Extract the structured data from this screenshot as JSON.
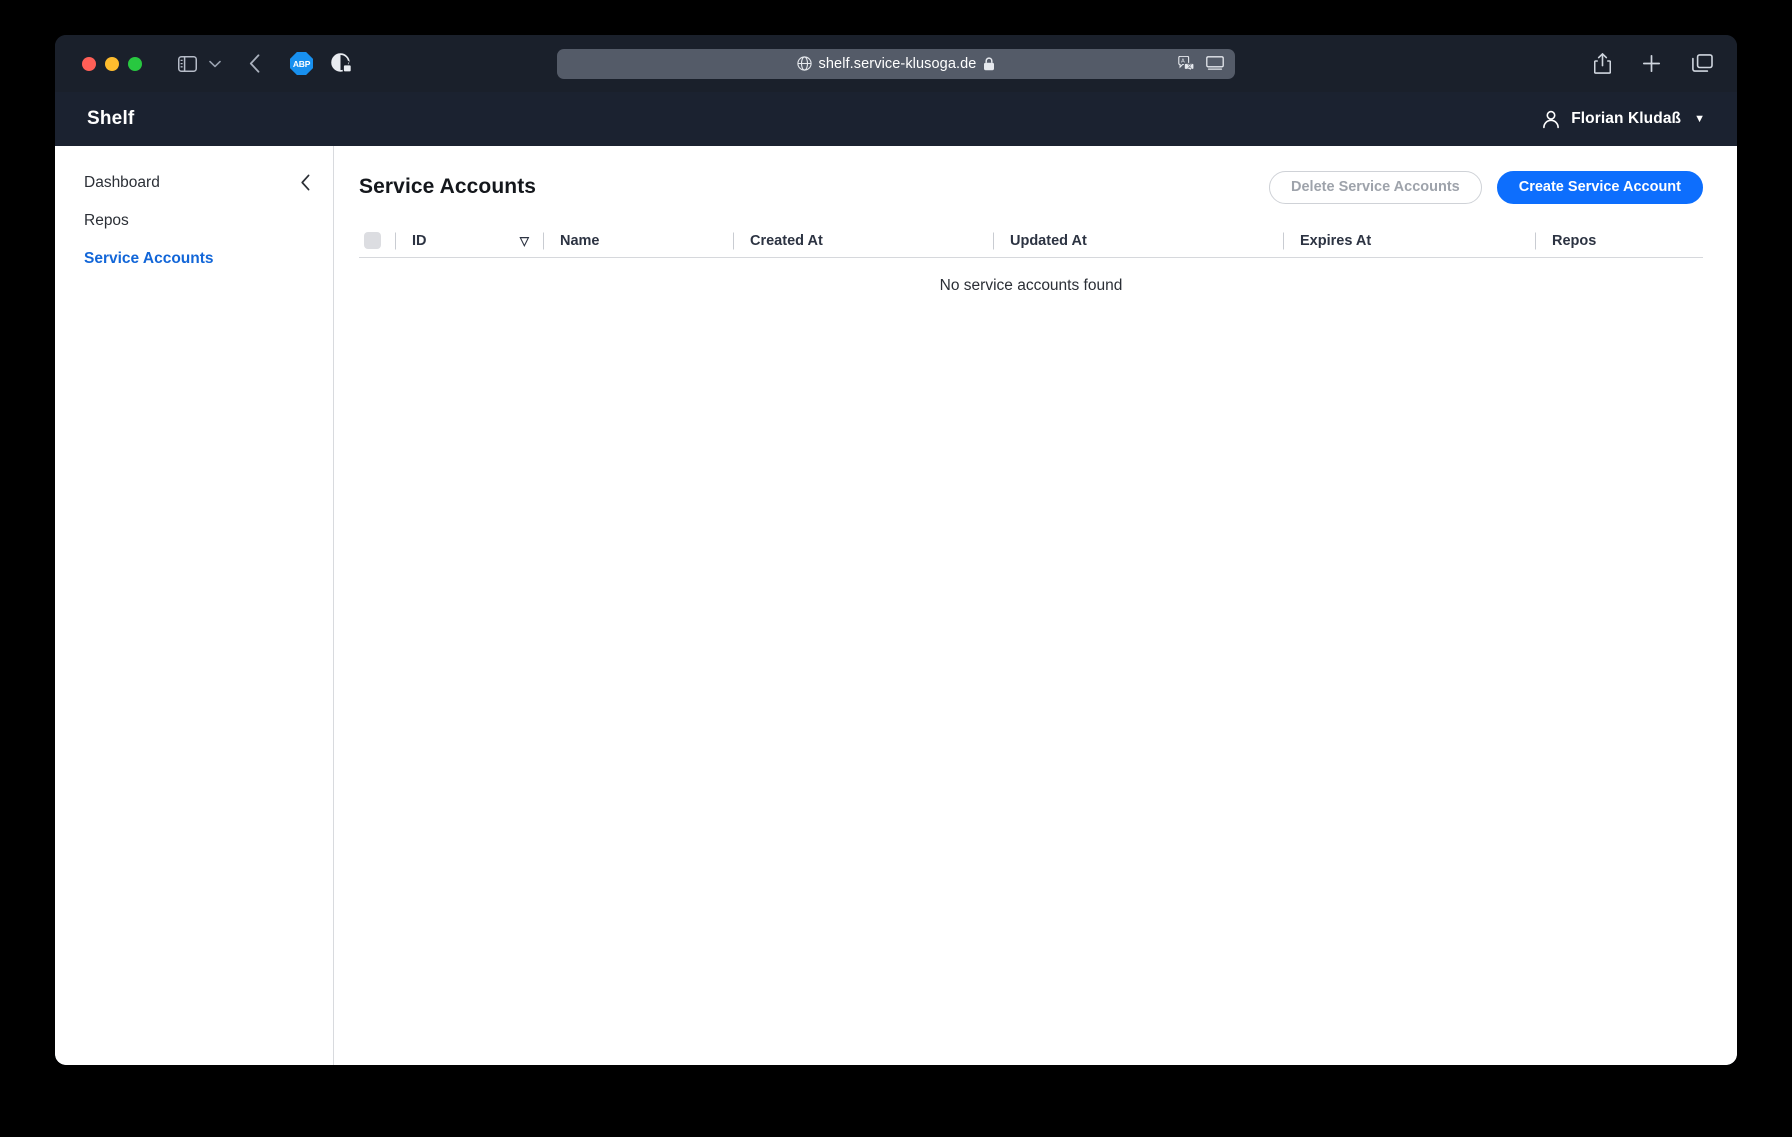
{
  "browser": {
    "url": "shelf.service-klusoga.de",
    "icons": {
      "globe": "globe-icon",
      "lock": "lock-icon",
      "sidebar_toggle": "sidebar-toggle-icon",
      "back": "back-arrow-icon",
      "adblock": "ABP",
      "privacy": "privacy-report-icon",
      "translate": "translate-icon",
      "reader": "reader-mode-icon",
      "share": "share-icon",
      "new_tab": "plus-icon",
      "tab_overview": "tab-overview-icon"
    }
  },
  "app": {
    "title": "Shelf",
    "user": {
      "name": "Florian Kludaß",
      "caret": "▼"
    }
  },
  "sidebar": {
    "collapse_icon": "‹",
    "items": [
      {
        "label": "Dashboard",
        "active": false
      },
      {
        "label": "Repos",
        "active": false
      },
      {
        "label": "Service Accounts",
        "active": true
      }
    ]
  },
  "main": {
    "page_title": "Service Accounts",
    "actions": {
      "delete_label": "Delete Service Accounts",
      "create_label": "Create Service Account"
    },
    "table": {
      "columns": [
        "ID",
        "Name",
        "Created At",
        "Updated At",
        "Expires At",
        "Repos"
      ],
      "sort_column": "ID",
      "sort_caret": "▽",
      "rows": [],
      "empty_message": "No service accounts found"
    }
  },
  "colors": {
    "accent": "#0d6efd",
    "active_nav": "#1266d8",
    "header_bg": "#1b2230",
    "toolbar_bg": "#1a202b",
    "url_bar_bg": "#545b68"
  }
}
